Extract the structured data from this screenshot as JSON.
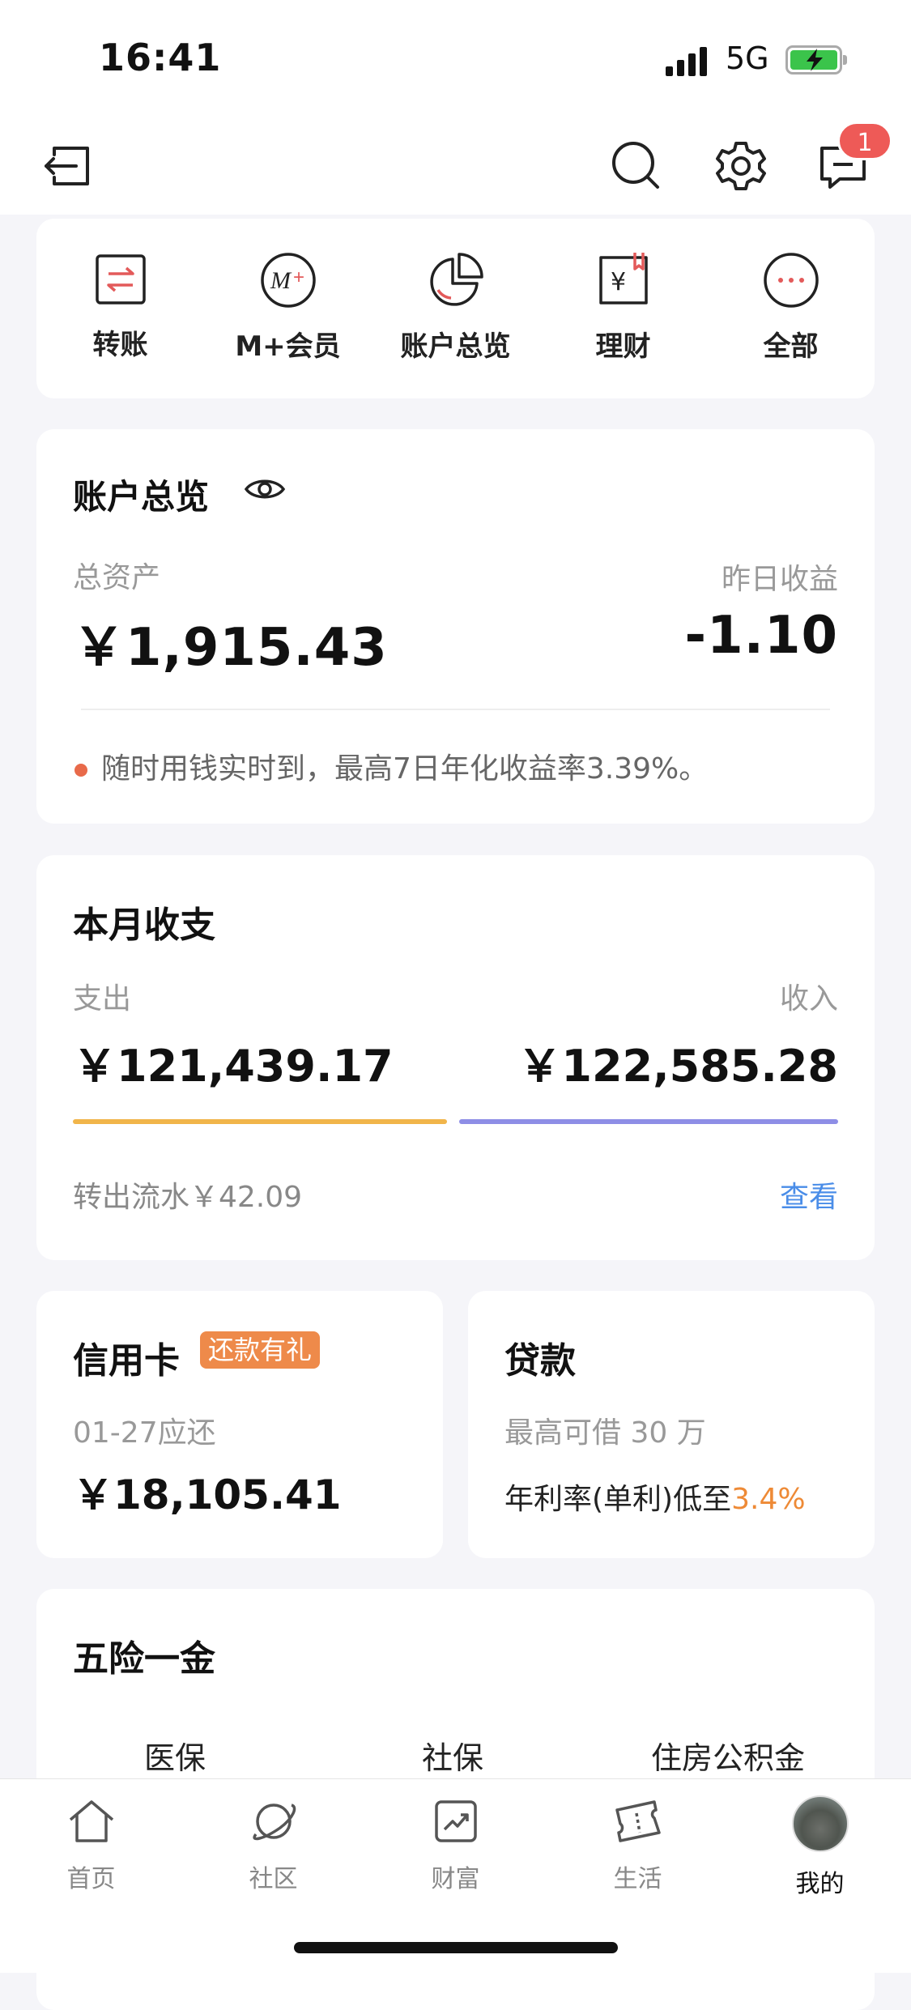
{
  "status": {
    "time": "16:41",
    "network": "5G"
  },
  "header": {
    "notification_count": "1"
  },
  "quick_actions": [
    {
      "label": "转账",
      "icon": "transfer-icon"
    },
    {
      "label": "M+会员",
      "icon": "mplus-member-icon"
    },
    {
      "label": "账户总览",
      "icon": "pie-chart-icon"
    },
    {
      "label": "理财",
      "icon": "wealth-management-icon"
    },
    {
      "label": "全部",
      "icon": "more-icon"
    }
  ],
  "account": {
    "title": "账户总览",
    "total_assets_label": "总资产",
    "total_assets": "￥1,915.43",
    "yesterday_label": "昨日收益",
    "yesterday_value": "-1.10",
    "notice": "随时用钱实时到，最高7日年化收益率3.39%。"
  },
  "monthly": {
    "title": "本月收支",
    "expense_label": "支出",
    "expense": "￥121,439.17",
    "income_label": "收入",
    "income": "￥122,585.28",
    "flow_text": "转出流水￥42.09",
    "view_label": "查看",
    "colors": {
      "expense": "#f1b54a",
      "income": "#8e8ee6"
    }
  },
  "credit": {
    "title": "信用卡",
    "tag": "还款有礼",
    "due_label": "01-27应还",
    "amount": "￥18,105.41"
  },
  "loan": {
    "title": "贷款",
    "limit_text": "最高可借 30 万",
    "rate_prefix": "年利率(单利)低至",
    "rate_value": "3.4%"
  },
  "insurance": {
    "title": "五险一金",
    "items": [
      "医保",
      "社保",
      "住房公积金"
    ]
  },
  "tabbar": {
    "items": [
      {
        "label": "首页",
        "icon": "home-icon"
      },
      {
        "label": "社区",
        "icon": "community-planet-icon"
      },
      {
        "label": "财富",
        "icon": "wealth-chart-icon"
      },
      {
        "label": "生活",
        "icon": "ticket-icon"
      },
      {
        "label": "我的",
        "icon": "avatar"
      }
    ],
    "active": "我的"
  }
}
